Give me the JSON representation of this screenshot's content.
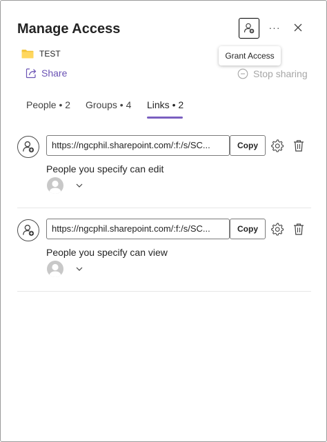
{
  "header": {
    "title": "Manage Access",
    "more_label": "···",
    "tooltip": "Grant Access"
  },
  "item": {
    "name": "TEST",
    "icon": "folder-icon",
    "color": "#F4C53B"
  },
  "actions": {
    "share_label": "Share",
    "stop_sharing_label": "Stop sharing"
  },
  "tabs": [
    {
      "label": "People • 2",
      "active": false
    },
    {
      "label": "Groups • 4",
      "active": false
    },
    {
      "label": "Links • 2",
      "active": true
    }
  ],
  "links": [
    {
      "url": "https://ngcphil.sharepoint.com/:f:/s/SC...",
      "copy_label": "Copy",
      "permission": "People you specify can edit"
    },
    {
      "url": "https://ngcphil.sharepoint.com/:f:/s/SC...",
      "copy_label": "Copy",
      "permission": "People you specify can view"
    }
  ],
  "colors": {
    "accent": "#7A5FC0",
    "share": "#6A52B4",
    "disabled": "#A6A6A6"
  }
}
